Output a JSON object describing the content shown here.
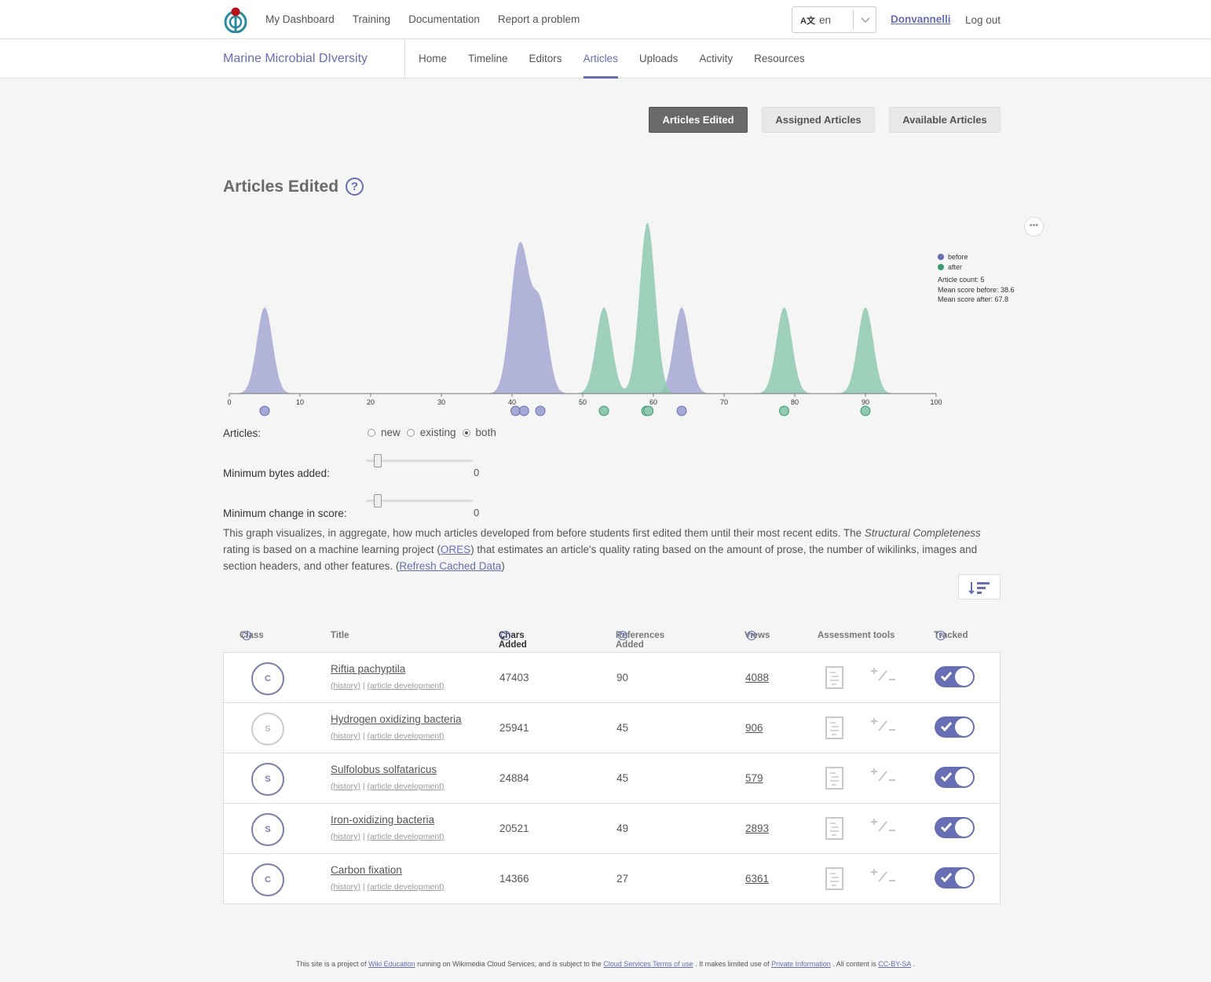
{
  "topnav": {
    "items": [
      "My Dashboard",
      "Training",
      "Documentation",
      "Report a problem"
    ],
    "lang_code": "en",
    "user": "Donvannelli",
    "logout": "Log out"
  },
  "course": {
    "title": "Marine Microbial DIversity",
    "tabs": [
      "Home",
      "Timeline",
      "Editors",
      "Articles",
      "Uploads",
      "Activity",
      "Resources"
    ],
    "active_tab": "Articles"
  },
  "views": {
    "edited": "Articles Edited",
    "assigned": "Assigned Articles",
    "available": "Available Articles"
  },
  "section_title": "Articles Edited",
  "chart_data": {
    "type": "area",
    "xlim": [
      0,
      100
    ],
    "x_ticks": [
      0,
      10,
      20,
      30,
      40,
      50,
      60,
      70,
      80,
      90,
      100
    ],
    "series": [
      {
        "name": "before",
        "color": "#a5a7d4",
        "points": [
          5,
          40.5,
          41.7,
          44,
          64
        ]
      },
      {
        "name": "after",
        "color": "#8ec9b0",
        "points": [
          53,
          59,
          59.3,
          78.5,
          90
        ]
      }
    ],
    "stats": {
      "count": "Article count: 5",
      "mean_before": "Mean score before: 38.6",
      "mean_after": "Mean score after: 67.8"
    }
  },
  "controls": {
    "articles_label": "Articles:",
    "radio_new": "new",
    "radio_existing": "existing",
    "radio_both": "both",
    "bytes_label": "Minimum bytes added:",
    "bytes_value": "0",
    "score_label": "Minimum change in score:",
    "score_value": "0"
  },
  "description": {
    "p1": "This graph visualizes, in aggregate, how much articles developed from before students first edited them until their most recent edits. The ",
    "em": "Structural Completeness",
    "p2": " rating is based on a machine learning project (",
    "link_ores": "ORES",
    "p3": ") that estimates an article's quality rating based on the amount of prose, the number of wikilinks, images and section headers, and other features. (",
    "link_refresh": "Refresh Cached Data",
    "p4": ")"
  },
  "table": {
    "headers": {
      "class": "Class",
      "title": "Title",
      "chars": "Chars Added",
      "refs": "References Added",
      "views": "Views",
      "assess": "Assessment tools",
      "tracked": "Tracked"
    },
    "history_label": "(history)",
    "dev_label": "(article development)",
    "rows": [
      {
        "cls": "C",
        "title": "Riftia pachyptila",
        "chars": "47403",
        "refs": "90",
        "views": "4088",
        "light": false
      },
      {
        "cls": "S",
        "title": "Hydrogen oxidizing bacteria",
        "chars": "25941",
        "refs": "45",
        "views": "906",
        "light": true
      },
      {
        "cls": "S",
        "title": "Sulfolobus solfataricus",
        "chars": "24884",
        "refs": "45",
        "views": "579",
        "light": false
      },
      {
        "cls": "S",
        "title": "Iron-oxidizing bacteria",
        "chars": "20521",
        "refs": "49",
        "views": "2893",
        "light": false
      },
      {
        "cls": "C",
        "title": "Carbon fixation",
        "chars": "14366",
        "refs": "27",
        "views": "6361",
        "light": false
      }
    ]
  },
  "footer": {
    "t1": "This site is a project of ",
    "l1": "Wiki Education",
    "t2": " running on Wikimedia Cloud Services, and is subject to the ",
    "l2": "Cloud Services Terms of use",
    "t3": " . It makes limited use of ",
    "l3": "Private Information",
    "t4": " . All content is ",
    "l4": "CC-BY-SA",
    "t5": " ."
  }
}
